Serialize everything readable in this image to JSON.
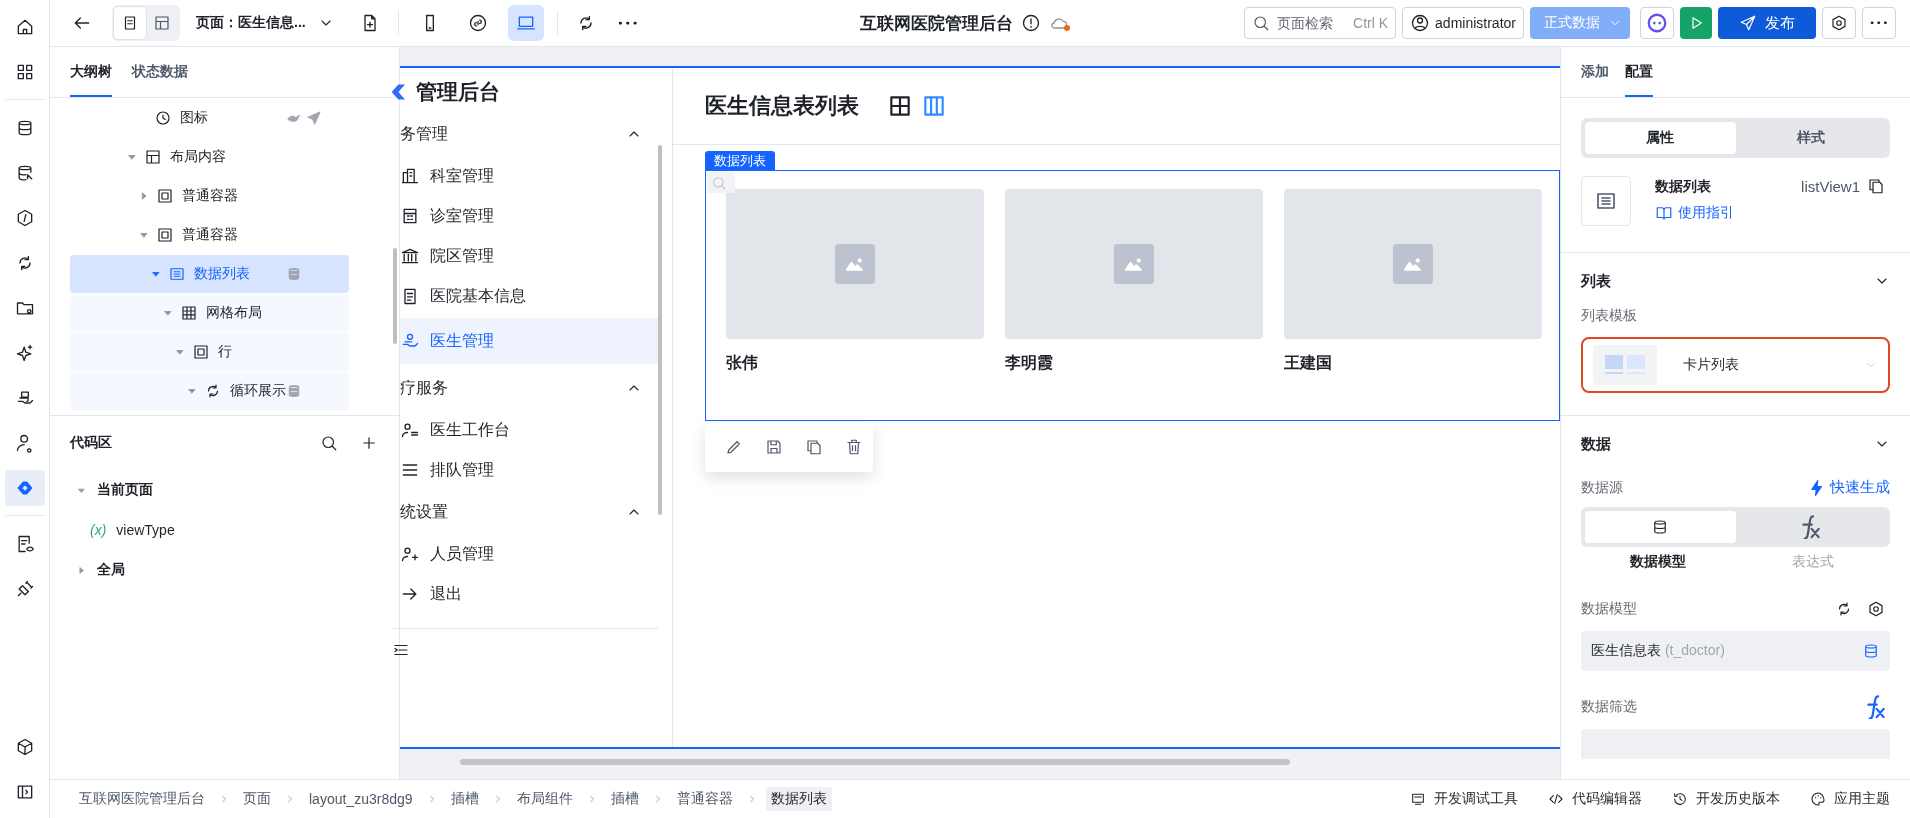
{
  "rail": {
    "groups": [
      [
        {
          "kind": "home",
          "selected": false
        },
        {
          "kind": "apps",
          "selected": false
        }
      ],
      [
        {
          "kind": "database",
          "selected": false
        },
        {
          "kind": "database-search",
          "selected": false
        },
        {
          "kind": "hexagon",
          "selected": false
        },
        {
          "kind": "loop",
          "selected": false
        },
        {
          "kind": "folder",
          "selected": false
        },
        {
          "kind": "sparkle",
          "selected": false
        },
        {
          "kind": "hand",
          "selected": false
        },
        {
          "kind": "user",
          "selected": false
        },
        {
          "kind": "logo",
          "selected": true
        }
      ],
      [
        {
          "kind": "doc-eye",
          "selected": false
        },
        {
          "kind": "plug",
          "selected": false
        }
      ]
    ],
    "bottom": [
      {
        "kind": "cube",
        "selected": false
      },
      {
        "kind": "sidebar",
        "selected": false
      }
    ]
  },
  "toolbar": {
    "view_modes": [
      {
        "kind": "outline",
        "selected": true
      },
      {
        "kind": "layout",
        "selected": false
      }
    ],
    "page_select": "页面：医生信息...",
    "devices": [
      {
        "kind": "mobile",
        "selected": false
      },
      {
        "kind": "mini",
        "selected": false
      },
      {
        "kind": "desktop",
        "selected": true
      }
    ],
    "app_title": "互联网医院管理后台",
    "unsaved": true,
    "search": {
      "placeholder": "页面检索",
      "shortcut": "Ctrl K"
    },
    "user": "administrator",
    "env": "正式数据",
    "publish": "发布"
  },
  "left_tabs": [
    {
      "label": "大纲树",
      "selected": true
    },
    {
      "label": "状态数据",
      "selected": false
    }
  ],
  "outline": [
    {
      "label": "图标",
      "kind": "icon",
      "selected": false,
      "styled": true,
      "data_bound": false
    },
    {
      "label": "布局内容",
      "kind": "layout",
      "selected": false,
      "expanded": true,
      "styled": false,
      "data_bound": false,
      "children": [
        {
          "label": "普通容器",
          "kind": "container",
          "selected": false,
          "expanded": false,
          "styled": false,
          "data_bound": false
        },
        {
          "label": "普通容器",
          "kind": "container",
          "selected": false,
          "expanded": true,
          "styled": false,
          "data_bound": false,
          "children": [
            {
              "label": "数据列表",
              "kind": "list",
              "selected": true,
              "expanded": true,
              "styled": false,
              "data_bound": true,
              "children": [
                {
                  "label": "网格布局",
                  "kind": "grid",
                  "selected": false,
                  "expanded": true,
                  "styled": false,
                  "data_bound": false,
                  "children": [
                    {
                      "label": "行",
                      "kind": "container",
                      "selected": false,
                      "expanded": true,
                      "styled": false,
                      "data_bound": false,
                      "children": [
                        {
                          "label": "循环展示",
                          "kind": "loop",
                          "selected": false,
                          "expanded": true,
                          "styled": false,
                          "data_bound": true
                        }
                      ]
                    }
                  ]
                }
              ]
            }
          ]
        }
      ]
    }
  ],
  "code": {
    "title": "代码区",
    "tree": [
      {
        "label": "当前页面",
        "expanded": true,
        "children": [
          {
            "prefix": "(x)",
            "label": "viewType"
          }
        ]
      },
      {
        "label": "全局",
        "expanded": false
      }
    ]
  },
  "preview": {
    "app_name": "管理后台",
    "menu": [
      {
        "label": "务管理",
        "expanded": true,
        "children": [
          {
            "label": "科室管理",
            "kind": "building",
            "selected": false
          },
          {
            "label": "诊室管理",
            "kind": "calendar",
            "selected": false
          },
          {
            "label": "院区管理",
            "kind": "bank",
            "selected": false
          },
          {
            "label": "医院基本信息",
            "kind": "clipboard",
            "selected": false
          },
          {
            "label": "医生管理",
            "kind": "doctor",
            "selected": true
          }
        ]
      },
      {
        "label": "疗服务",
        "expanded": true,
        "children": [
          {
            "label": "医生工作台",
            "kind": "user-list",
            "selected": false
          },
          {
            "label": "排队管理",
            "kind": "queue",
            "selected": false
          }
        ]
      },
      {
        "label": "统设置",
        "expanded": true,
        "children": [
          {
            "label": "人员管理",
            "kind": "user-add",
            "selected": false
          },
          {
            "label": "退出",
            "kind": "logout",
            "selected": false
          }
        ]
      }
    ]
  },
  "page": {
    "title": "医生信息表列表",
    "view_toggle": [
      {
        "kind": "table",
        "selected": false
      },
      {
        "kind": "cards",
        "selected": true
      }
    ],
    "list_tag": "数据列表",
    "cards": [
      {
        "name": "张伟"
      },
      {
        "name": "李明霞"
      },
      {
        "name": "王建国"
      }
    ]
  },
  "right": {
    "tabs": [
      {
        "label": "添加",
        "selected": false
      },
      {
        "label": "配置",
        "selected": true
      }
    ],
    "segments": [
      {
        "label": "属性",
        "selected": true
      },
      {
        "label": "样式",
        "selected": false
      }
    ],
    "component": {
      "name": "数据列表",
      "id": "listView1",
      "guide": "使用指引"
    },
    "list_section": {
      "title": "列表",
      "expanded": true,
      "template_label": "列表模板",
      "template": "卡片列表"
    },
    "data_section": {
      "title": "数据",
      "expanded": true,
      "source_label": "数据源",
      "quick": "快速生成",
      "source_modes": [
        {
          "kind": "model",
          "label": "数据模型",
          "selected": true
        },
        {
          "kind": "expression",
          "label": "表达式",
          "selected": false
        }
      ],
      "model_label": "数据模型",
      "model": "医生信息表",
      "model_table": "(t_doctor)",
      "filter_label": "数据筛选"
    }
  },
  "bottom": {
    "breadcrumbs": [
      {
        "label": "互联网医院管理后台",
        "selected": false
      },
      {
        "label": "页面",
        "selected": false
      },
      {
        "label": "layout_zu3r8dg9",
        "selected": false
      },
      {
        "label": "插槽",
        "selected": false
      },
      {
        "label": "布局组件",
        "selected": false
      },
      {
        "label": "插槽",
        "selected": false
      },
      {
        "label": "普通容器",
        "selected": false
      },
      {
        "label": "数据列表",
        "selected": true
      }
    ],
    "tools": [
      {
        "kind": "debug",
        "label": "开发调试工具"
      },
      {
        "kind": "code",
        "label": "代码编辑器"
      },
      {
        "kind": "history",
        "label": "开发历史版本"
      },
      {
        "kind": "theme",
        "label": "应用主题"
      }
    ]
  }
}
